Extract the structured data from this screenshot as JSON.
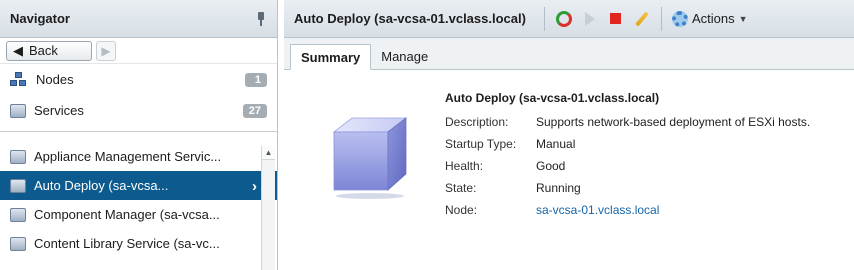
{
  "navigator": {
    "title": "Navigator",
    "back_label": "Back",
    "items": [
      {
        "label": "Nodes",
        "count": "1"
      },
      {
        "label": "Services",
        "count": "27"
      }
    ],
    "services": [
      {
        "label": "Appliance Management Servic..."
      },
      {
        "label": "Auto Deploy (sa-vcsa..."
      },
      {
        "label": "Component Manager (sa-vcsa..."
      },
      {
        "label": "Content Library Service (sa-vc..."
      }
    ]
  },
  "main": {
    "title": "Auto Deploy (sa-vcsa-01.vclass.local)",
    "actions_label": "Actions",
    "tabs": [
      {
        "label": "Summary"
      },
      {
        "label": "Manage"
      }
    ],
    "summary": {
      "title": "Auto Deploy (sa-vcsa-01.vclass.local)",
      "rows": [
        {
          "key": "Description:",
          "value": "Supports network-based deployment of ESXi hosts."
        },
        {
          "key": "Startup Type:",
          "value": "Manual"
        },
        {
          "key": "Health:",
          "value": "Good"
        },
        {
          "key": "State:",
          "value": "Running"
        },
        {
          "key": "Node:",
          "value": "sa-vcsa-01.vclass.local"
        }
      ]
    }
  },
  "colors": {
    "selected": "#0c5a8e",
    "link": "#1565a8"
  },
  "icons": {
    "refresh": "refresh-icon",
    "start": "play-icon",
    "stop": "stop-icon",
    "edit": "pencil-icon",
    "actions": "gear-icon"
  }
}
